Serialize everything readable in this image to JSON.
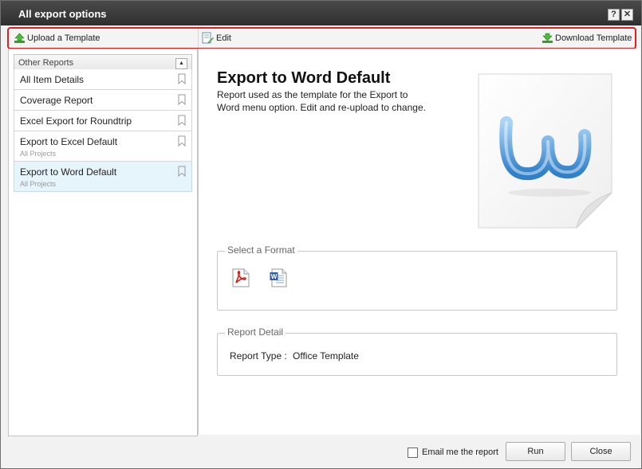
{
  "window": {
    "title": "All export options"
  },
  "toolbar": {
    "upload_label": "Upload a Template",
    "edit_label": "Edit",
    "download_label": "Download Template"
  },
  "sidebar": {
    "header": "Other Reports",
    "items": [
      {
        "label": "All Item Details",
        "sub": ""
      },
      {
        "label": "Coverage Report",
        "sub": ""
      },
      {
        "label": "Excel Export for Roundtrip",
        "sub": ""
      },
      {
        "label": "Export to Excel Default",
        "sub": "All Projects"
      },
      {
        "label": "Export to Word Default",
        "sub": "All Projects",
        "selected": true
      }
    ]
  },
  "detail": {
    "title": "Export to Word Default",
    "description": "Report used as the template for the Export to Word menu option. Edit and re-upload to change.",
    "format_legend": "Select a Format",
    "formats": [
      "pdf-icon",
      "word-icon"
    ],
    "report_detail_legend": "Report Detail",
    "report_type_label": "Report Type :",
    "report_type_value": "Office Template"
  },
  "footer": {
    "email_label": "Email me the report",
    "email_checked": false,
    "run_label": "Run",
    "close_label": "Close"
  },
  "colors": {
    "toolbar_highlight": "#e02020",
    "selected_row": "#e6f4fb",
    "titlebar": "#3a3a3a"
  }
}
